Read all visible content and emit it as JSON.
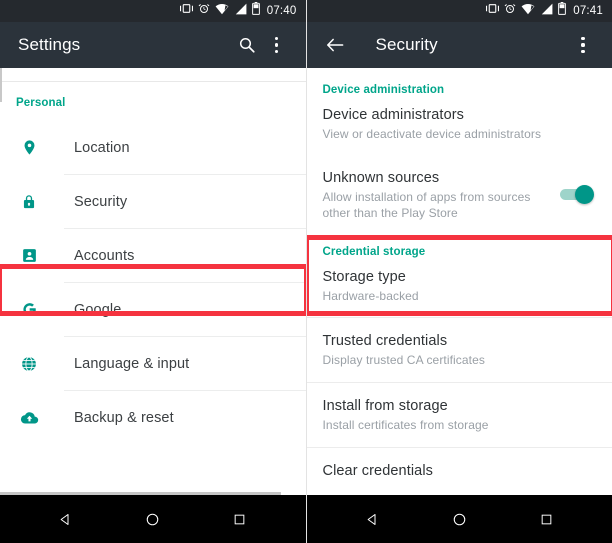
{
  "left_panel": {
    "status_bar": {
      "time": "07:40",
      "icons": [
        "vibrate-icon",
        "alarm-icon",
        "wifi-icon",
        "signal-icon",
        "battery-icon"
      ]
    },
    "toolbar": {
      "title": "Settings",
      "search_icon": "search-icon",
      "overflow_icon": "overflow-menu-icon"
    },
    "section_header": "Personal",
    "items": [
      {
        "label": "Location",
        "icon": "location-pin-icon"
      },
      {
        "label": "Security",
        "icon": "lock-icon",
        "highlighted": true
      },
      {
        "label": "Accounts",
        "icon": "account-icon"
      },
      {
        "label": "Google",
        "icon": "google-g-icon"
      },
      {
        "label": "Language & input",
        "icon": "globe-icon"
      },
      {
        "label": "Backup & reset",
        "icon": "cloud-upload-icon"
      }
    ]
  },
  "right_panel": {
    "status_bar": {
      "time": "07:41",
      "icons": [
        "vibrate-icon",
        "alarm-icon",
        "wifi-icon",
        "signal-icon",
        "battery-icon"
      ]
    },
    "toolbar": {
      "back_icon": "back-arrow-icon",
      "title": "Security",
      "overflow_icon": "overflow-menu-icon"
    },
    "sections": [
      {
        "header": "Device administration",
        "items": [
          {
            "title": "Device administrators",
            "subtitle": "View or deactivate device administrators"
          },
          {
            "title": "Unknown sources",
            "subtitle": "Allow installation of apps from sources other than the Play Store",
            "toggle": "on",
            "highlighted": true
          }
        ]
      },
      {
        "header": "Credential storage",
        "items": [
          {
            "title": "Storage type",
            "subtitle": "Hardware-backed"
          },
          {
            "title": "Trusted credentials",
            "subtitle": "Display trusted CA certificates"
          },
          {
            "title": "Install from storage",
            "subtitle": "Install certificates from storage"
          },
          {
            "title": "Clear credentials",
            "subtitle": ""
          }
        ]
      }
    ]
  },
  "nav_bar": {
    "back": "back-triangle-icon",
    "home": "home-circle-icon",
    "recents": "recents-square-icon"
  },
  "colors": {
    "accent_teal": "#009688",
    "section_header_teal": "#00a58a",
    "highlight_red": "#f5333f",
    "toolbar_dark": "#2b333b",
    "statusbar_dark": "#25292e"
  }
}
